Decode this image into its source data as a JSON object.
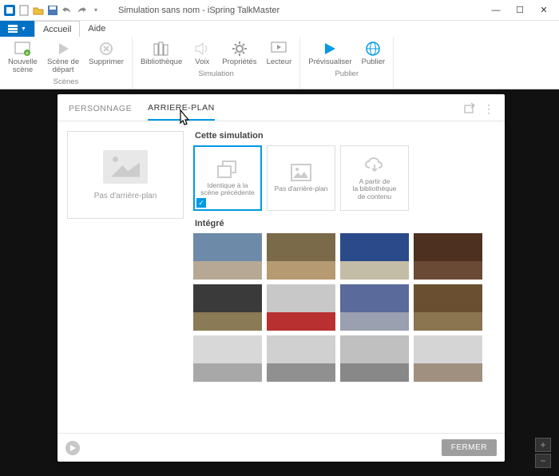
{
  "titlebar": {
    "title": "Simulation sans nom - iSpring TalkMaster"
  },
  "file_tab": "",
  "tabs": {
    "home": "Accueil",
    "help": "Aide"
  },
  "ribbon": {
    "groups": {
      "scenes": {
        "label": "Scènes",
        "items": {
          "new_scene": "Nouvelle\nscène",
          "start_scene": "Scène de\ndépart",
          "delete": "Supprimer"
        }
      },
      "simulation": {
        "label": "Simulation",
        "items": {
          "library": "Bibliothèque",
          "voice": "Voix",
          "properties": "Propriétés",
          "player": "Lecteur"
        }
      },
      "publish": {
        "label": "Publier",
        "items": {
          "preview": "Prévisualiser",
          "publish": "Publier"
        }
      }
    }
  },
  "panel": {
    "tabs": {
      "character": "PERSONNAGE",
      "background": "ARRIERE-PLAN"
    },
    "preview_label": "Pas d'arrière-plan",
    "sections": {
      "this_sim": "Cette simulation",
      "builtin": "Intégré"
    },
    "sim_cards": {
      "same": "Identique à la\nscène précédente",
      "none": "Pas d'arrière-plan",
      "cloud": "A partir de\nla bibliothèque\nde contenu"
    },
    "close": "FERMER"
  },
  "thumbs": [
    {
      "sky": "#6d8aa8",
      "floor": "#b6a895"
    },
    {
      "sky": "#7a6a4a",
      "floor": "#b59a72"
    },
    {
      "sky": "#2a4a8a",
      "floor": "#c3bca6"
    },
    {
      "sky": "#4d3020",
      "floor": "#6a4a35"
    },
    {
      "sky": "#3a3a3a",
      "floor": "#8a7a55"
    },
    {
      "sky": "#c8c8c8",
      "floor": "#b83030"
    },
    {
      "sky": "#5a6a9a",
      "floor": "#9aa0b0"
    },
    {
      "sky": "#6a5030",
      "floor": "#8a7550"
    },
    {
      "sky": "#d8d8d8",
      "floor": "#a8a8a8"
    },
    {
      "sky": "#d0d0d0",
      "floor": "#909090"
    },
    {
      "sky": "#c0c0c0",
      "floor": "#888888"
    },
    {
      "sky": "#d5d5d5",
      "floor": "#a09080"
    }
  ]
}
